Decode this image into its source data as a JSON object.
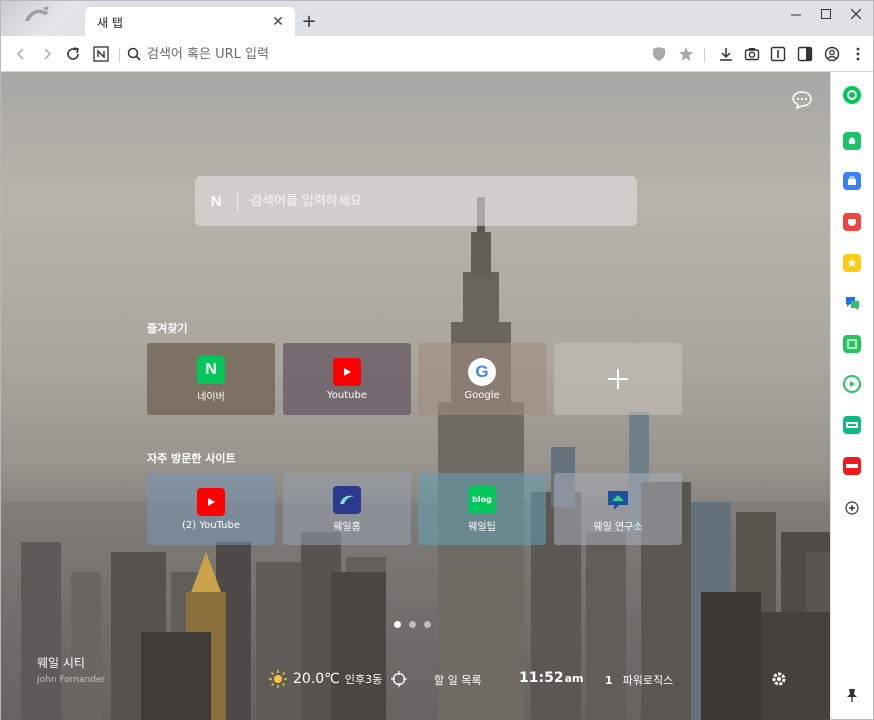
{
  "browser": {
    "tab_title": "새 탭",
    "address_placeholder": "검색어 혹은 URL 입력"
  },
  "search": {
    "placeholder": "검색어를 입력하세요",
    "logo_letter": "N"
  },
  "favorites": {
    "title": "즐겨찾기",
    "items": [
      {
        "label": "네이버",
        "icon": "naver-icon",
        "icon_text": "N",
        "color": "#03c75a"
      },
      {
        "label": "Youtube",
        "icon": "youtube-icon",
        "color": "#ff0000"
      },
      {
        "label": "Google",
        "icon": "google-icon",
        "icon_text": "G",
        "color": "#4285f4"
      }
    ],
    "add_icon": "plus-icon"
  },
  "frequent": {
    "title": "자주 방문한 사이트",
    "items": [
      {
        "label": "(2) YouTube",
        "icon": "youtube-icon",
        "color": "#ff0000"
      },
      {
        "label": "웨일홈",
        "icon": "whale-home-icon",
        "color": "#2b3a8f"
      },
      {
        "label": "웨일팁",
        "icon": "blog-icon",
        "icon_text": "blog",
        "color": "#03c75a"
      },
      {
        "label": "웨일 연구소",
        "icon": "whale-lab-icon",
        "color": "#1e4fa0"
      }
    ]
  },
  "bottom_bar": {
    "city": "웨일 시티",
    "author": "John Fornander",
    "temperature": "20.0℃",
    "location": "인후3동",
    "todo": "할 일 목록",
    "time_main": "11:52",
    "time_ampm": "am",
    "rank_number": "1",
    "rank_keyword": "파워로직스"
  },
  "colors": {
    "whale_green": "#03c75a",
    "youtube_red": "#ff0000"
  }
}
